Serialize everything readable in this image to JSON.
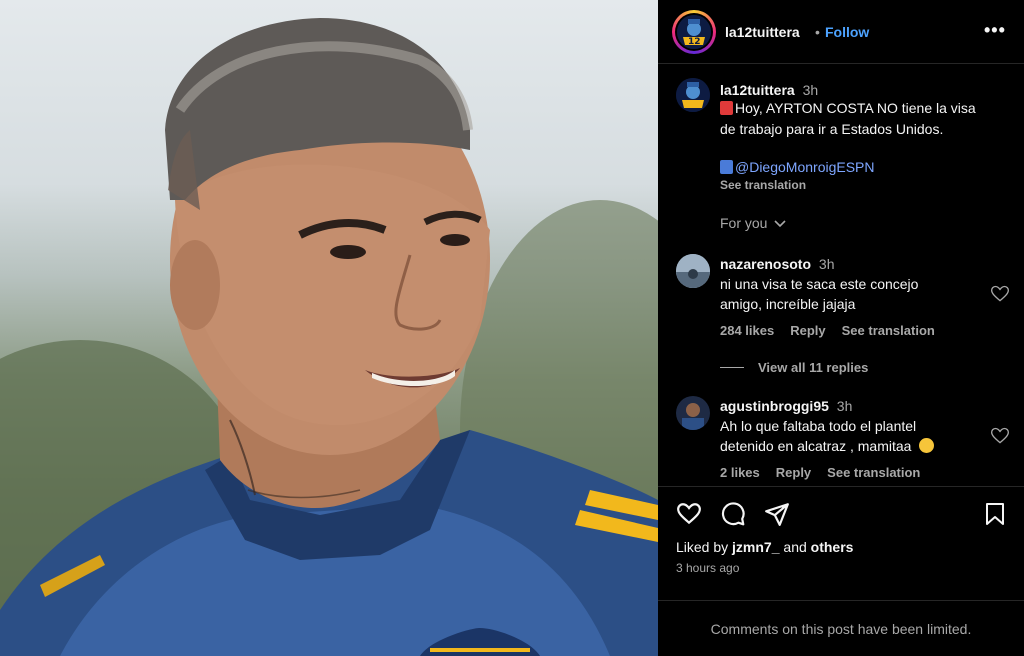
{
  "post": {
    "author": "la12tuittera",
    "separator": "•",
    "follow_label": "Follow",
    "more_label": "•••"
  },
  "caption": {
    "author": "la12tuittera",
    "time": "3h",
    "line1": "Hoy, AYRTON COSTA NO tiene la visa",
    "line2": "de trabajo para ir a Estados Unidos.",
    "mention": "@DiegoMonroigESPN",
    "see_translation": "See translation"
  },
  "sort": {
    "label": "For you"
  },
  "comments": [
    {
      "user": "nazarenosoto",
      "time": "3h",
      "line1": "ni una visa te saca este concejo",
      "line2": "amigo, increíble jajaja",
      "likes": "284 likes",
      "reply": "Reply",
      "translate": "See translation",
      "view_replies": "View all 11 replies"
    },
    {
      "user": "agustinbroggi95",
      "time": "3h",
      "line1": "Ah lo que faltaba todo el plantel",
      "line2": "detenido en alcatraz , mamitaa",
      "likes": "2 likes",
      "reply": "Reply",
      "translate": "See translation"
    }
  ],
  "footer": {
    "liked_by_prefix": "Liked by",
    "liked_by_user": "jzmn7_",
    "liked_by_and": "and",
    "liked_by_others": "others",
    "time_ago": "3 hours ago",
    "comments_limited": "Comments on this post have been limited."
  },
  "icons": [
    "heart-icon",
    "comment-icon",
    "share-icon",
    "bookmark-icon",
    "more-icon",
    "chevron-down-icon"
  ],
  "colors": {
    "link": "#4da3ff",
    "mention": "#7ea6ff",
    "muted": "#a8a8a8",
    "shirt": "#2c4f86",
    "stripe": "#f2b81c"
  }
}
